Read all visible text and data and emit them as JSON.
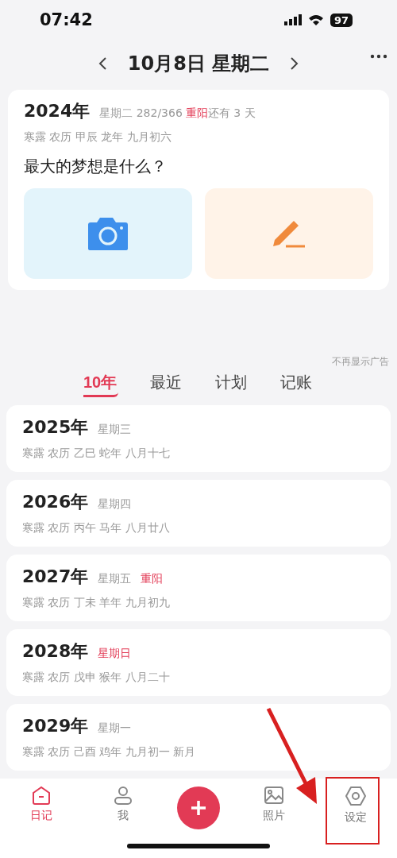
{
  "status_bar": {
    "time": "07:42",
    "battery": "97"
  },
  "header": {
    "title": "10月8日 星期二"
  },
  "today": {
    "year": "2024年",
    "weekday": "星期二 282/366",
    "festival": "重阳",
    "countdown": "还有 3 天",
    "lunar": "寒露 农历 甲辰 龙年 九月初六",
    "question": "最大的梦想是什么？"
  },
  "ad_dismiss": "不再显示广告",
  "tabs": [
    {
      "label": "10年",
      "selected": true
    },
    {
      "label": "最近",
      "selected": false
    },
    {
      "label": "计划",
      "selected": false
    },
    {
      "label": "记账",
      "selected": false
    }
  ],
  "years": [
    {
      "year": "2025年",
      "weekday": "星期三",
      "weekend": false,
      "lunar": "寒露 农历 乙巳 蛇年 八月十七"
    },
    {
      "year": "2026年",
      "weekday": "星期四",
      "weekend": false,
      "lunar": "寒露 农历 丙午 马年 八月廿八"
    },
    {
      "year": "2027年",
      "weekday": "星期五",
      "weekend": false,
      "festival": "重阳",
      "lunar": "寒露 农历 丁未 羊年 九月初九"
    },
    {
      "year": "2028年",
      "weekday": "星期日",
      "weekend": true,
      "lunar": "寒露 农历 戊申 猴年 八月二十"
    },
    {
      "year": "2029年",
      "weekday": "星期一",
      "weekend": false,
      "lunar": "寒露 农历 己酉 鸡年 九月初一 新月"
    }
  ],
  "tab_bar": [
    {
      "kind": "diary",
      "label": "日记",
      "selected": true
    },
    {
      "kind": "me",
      "label": "我",
      "selected": false
    },
    {
      "kind": "add"
    },
    {
      "kind": "photos",
      "label": "照片",
      "selected": false
    },
    {
      "kind": "settings",
      "label": "设定",
      "selected": false
    }
  ]
}
